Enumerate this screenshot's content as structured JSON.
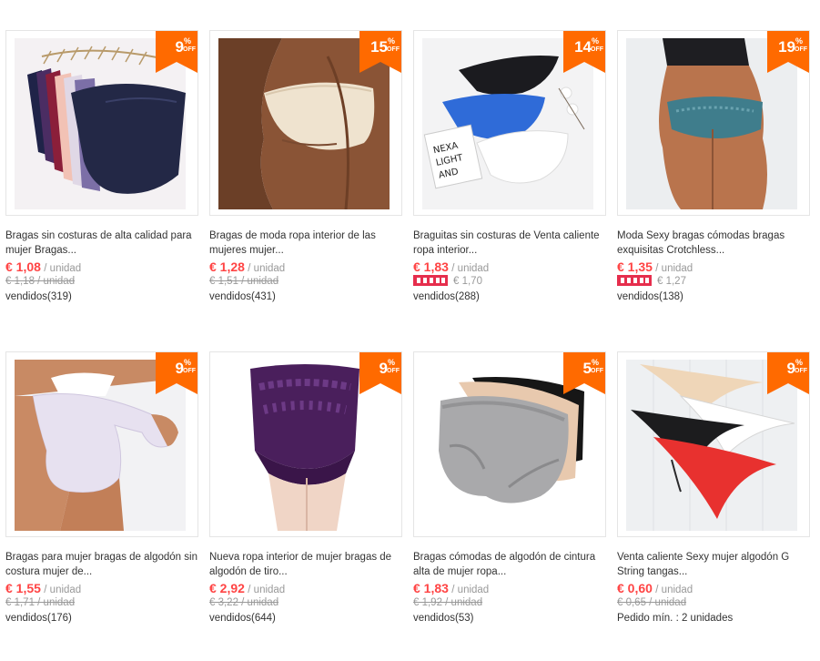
{
  "colors": {
    "badge": "#ff6a00",
    "price": "#ff4444",
    "promo_tag": "#e62e4d"
  },
  "discount_suffix": {
    "percent": "%",
    "off": "OFF"
  },
  "products": [
    {
      "image": "navy-panties-on-hangers",
      "discount": "9",
      "title": "Bragas sin costuras de alta calidad para mujer Bragas...",
      "price": "€ 1,08",
      "unit": "/ unidad",
      "old_price": "€ 1,18 / unidad",
      "promo_price": "",
      "sold": "vendidos(319)"
    },
    {
      "image": "beige-seamless-briefs",
      "discount": "15",
      "title": "Bragas de moda ropa interior de las mujeres mujer...",
      "price": "€ 1,28",
      "unit": "/ unidad",
      "old_price": "€ 1,51 / unidad",
      "promo_price": "",
      "sold": "vendidos(431)"
    },
    {
      "image": "black-blue-white-panties",
      "discount": "14",
      "title": "Braguitas sin costuras de Venta caliente ropa interior...",
      "price": "€ 1,83",
      "unit": "/ unidad",
      "old_price": "",
      "promo_price": "€ 1,70",
      "sold": "vendidos(288)"
    },
    {
      "image": "teal-lace-thong",
      "discount": "19",
      "title": "Moda Sexy bragas cómodas bragas exquisitas Crotchless...",
      "price": "€ 1,35",
      "unit": "/ unidad",
      "old_price": "",
      "promo_price": "€ 1,27",
      "sold": "vendidos(138)"
    },
    {
      "image": "white-cotton-briefs",
      "discount": "9",
      "title": "Bragas para mujer bragas de algodón sin costura mujer de...",
      "price": "€ 1,55",
      "unit": "/ unidad",
      "old_price": "€ 1,71 / unidad",
      "promo_price": "",
      "sold": "vendidos(176)"
    },
    {
      "image": "purple-high-waist-briefs",
      "discount": "9",
      "title": "Nueva ropa interior de mujer bragas de algodón de tiro...",
      "price": "€ 2,92",
      "unit": "/ unidad",
      "old_price": "€ 3,22 / unidad",
      "promo_price": "",
      "sold": "vendidos(644)"
    },
    {
      "image": "grey-beige-black-briefs",
      "discount": "5",
      "title": "Bragas cómodas de algodón de cintura alta de mujer ropa...",
      "price": "€ 1,83",
      "unit": "/ unidad",
      "old_price": "€ 1,92 / unidad",
      "promo_price": "",
      "sold": "vendidos(53)"
    },
    {
      "image": "g-string-set",
      "discount": "9",
      "title": "Venta caliente Sexy mujer algodón G String tangas...",
      "price": "€ 0,60",
      "unit": "/ unidad",
      "old_price": "€ 0,65 / unidad",
      "promo_price": "",
      "sold": "Pedido mín. : 2 unidades"
    }
  ]
}
